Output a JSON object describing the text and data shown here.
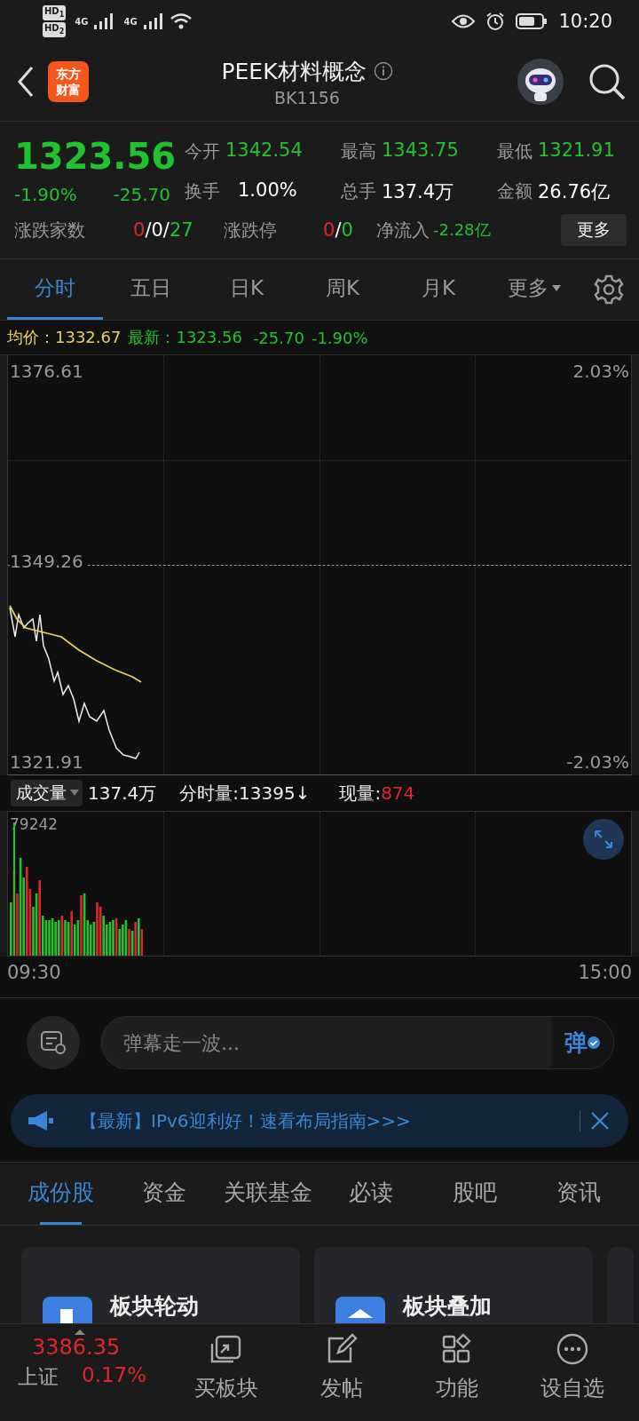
{
  "status_bar": {
    "sim_badges": [
      {
        "label": "HD",
        "slot": "1"
      },
      {
        "label": "HD",
        "slot": "2"
      }
    ],
    "networks": [
      "4G",
      "4G"
    ],
    "time": "10:20"
  },
  "header": {
    "logo_lines": [
      "东方",
      "财富"
    ],
    "title": "PEEK材料概念",
    "code": "BK1156"
  },
  "quote": {
    "price": "1323.56",
    "change_pct": "-1.90%",
    "change": "-25.70",
    "stats": [
      {
        "label": "今开",
        "value": "1342.54",
        "color": "#22c22e"
      },
      {
        "label": "最高",
        "value": "1343.75",
        "color": "#22c22e"
      },
      {
        "label": "最低",
        "value": "1321.91",
        "color": "#22c22e"
      },
      {
        "label": "换手",
        "value": "1.00%",
        "color": "#ffffff"
      },
      {
        "label": "总手",
        "value": "137.4万",
        "color": "#ffffff"
      },
      {
        "label": "金额",
        "value": "26.76亿",
        "color": "#ffffff"
      }
    ],
    "breadth": {
      "label": "涨跌家数",
      "parts": [
        {
          "text": "0",
          "color": "#e0262a"
        },
        {
          "text": "/0/",
          "color": "#ffffff"
        },
        {
          "text": "27",
          "color": "#22c22e"
        }
      ]
    },
    "limits": {
      "label": "涨跌停",
      "parts": [
        {
          "text": "0",
          "color": "#e0262a"
        },
        {
          "text": "/",
          "color": "#ffffff"
        },
        {
          "text": "0",
          "color": "#22c22e"
        }
      ]
    },
    "net_inflow": {
      "label": "净流入",
      "value": "-2.28亿",
      "color": "#22c22e"
    },
    "more_button": "更多"
  },
  "chart_tabs": [
    {
      "label": "分时",
      "selected": true,
      "kind": "tab"
    },
    {
      "label": "五日",
      "selected": false,
      "kind": "tab"
    },
    {
      "label": "日K",
      "selected": false,
      "kind": "tab"
    },
    {
      "label": "周K",
      "selected": false,
      "kind": "tab"
    },
    {
      "label": "月K",
      "selected": false,
      "kind": "tab"
    },
    {
      "label": "更多",
      "selected": false,
      "kind": "dropdown"
    }
  ],
  "price_info": {
    "avg_label": "均价：",
    "avg_value": "1332.67",
    "latest_label": "最新：",
    "latest_value": "1323.56",
    "change": "-25.70",
    "change_pct": "-1.90%"
  },
  "price_chart": {
    "high": "1376.61",
    "mid": "1349.26",
    "low": "1321.91",
    "high_pct": "2.03%",
    "low_pct": "-2.03%"
  },
  "volume": {
    "selector": "成交量",
    "total": "137.4万",
    "minute_label": "分时量:",
    "minute_value": "13395",
    "minute_arrow": "↓",
    "current_label": "现量:",
    "current_value": "874",
    "max": "79242",
    "start_time": "09:30",
    "end_time": "15:00"
  },
  "danmaku": {
    "placeholder": "弹幕走一波...",
    "send": "弹"
  },
  "banner": {
    "text": "【最新】IPv6迎利好！速看布局指南>>>"
  },
  "sections": [
    {
      "label": "成份股",
      "selected": true
    },
    {
      "label": "资金",
      "selected": false
    },
    {
      "label": "关联基金",
      "selected": false
    },
    {
      "label": "必读",
      "selected": false
    },
    {
      "label": "股吧",
      "selected": false
    },
    {
      "label": "资讯",
      "selected": false
    }
  ],
  "cards": [
    {
      "title": "板块轮动"
    },
    {
      "title": "板块叠加"
    }
  ],
  "bottom_bar": {
    "index": {
      "value": "3386.35",
      "name": "上证",
      "pct": "0.17%"
    },
    "items": [
      {
        "label": "买板块",
        "kind": "cards"
      },
      {
        "label": "发帖",
        "kind": "compose"
      },
      {
        "label": "功能",
        "kind": "grid"
      },
      {
        "label": "设自选",
        "kind": "more"
      }
    ]
  }
}
